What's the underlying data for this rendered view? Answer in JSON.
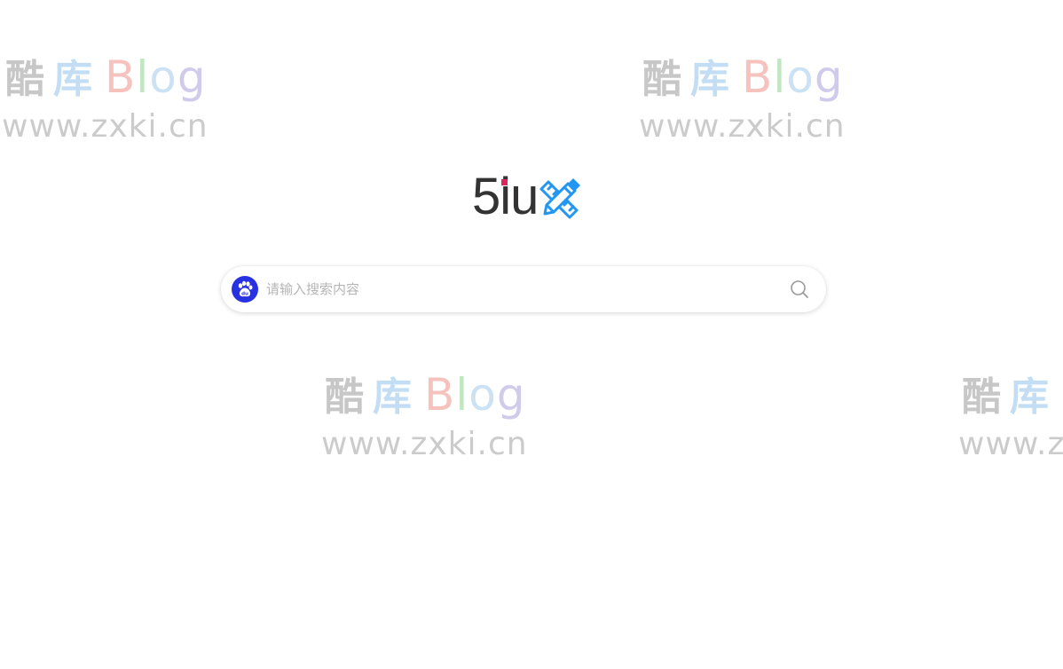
{
  "logo": {
    "text_prefix": "5",
    "text_i": "i",
    "text_suffix": "u",
    "icon": "pencil-ruler-icon",
    "dot_color": "#e0245e",
    "icon_color": "#2196f3"
  },
  "search": {
    "placeholder": "请输入搜索内容",
    "value": "",
    "engine_icon": "baidu-paw-icon",
    "engine_color": "#2932e1",
    "button_icon": "search-icon"
  },
  "watermark": {
    "char1": "酷",
    "char2": "库",
    "blog_b": "B",
    "blog_l": "l",
    "blog_o": "o",
    "blog_g": "g",
    "url": "www.zxki.cn"
  }
}
